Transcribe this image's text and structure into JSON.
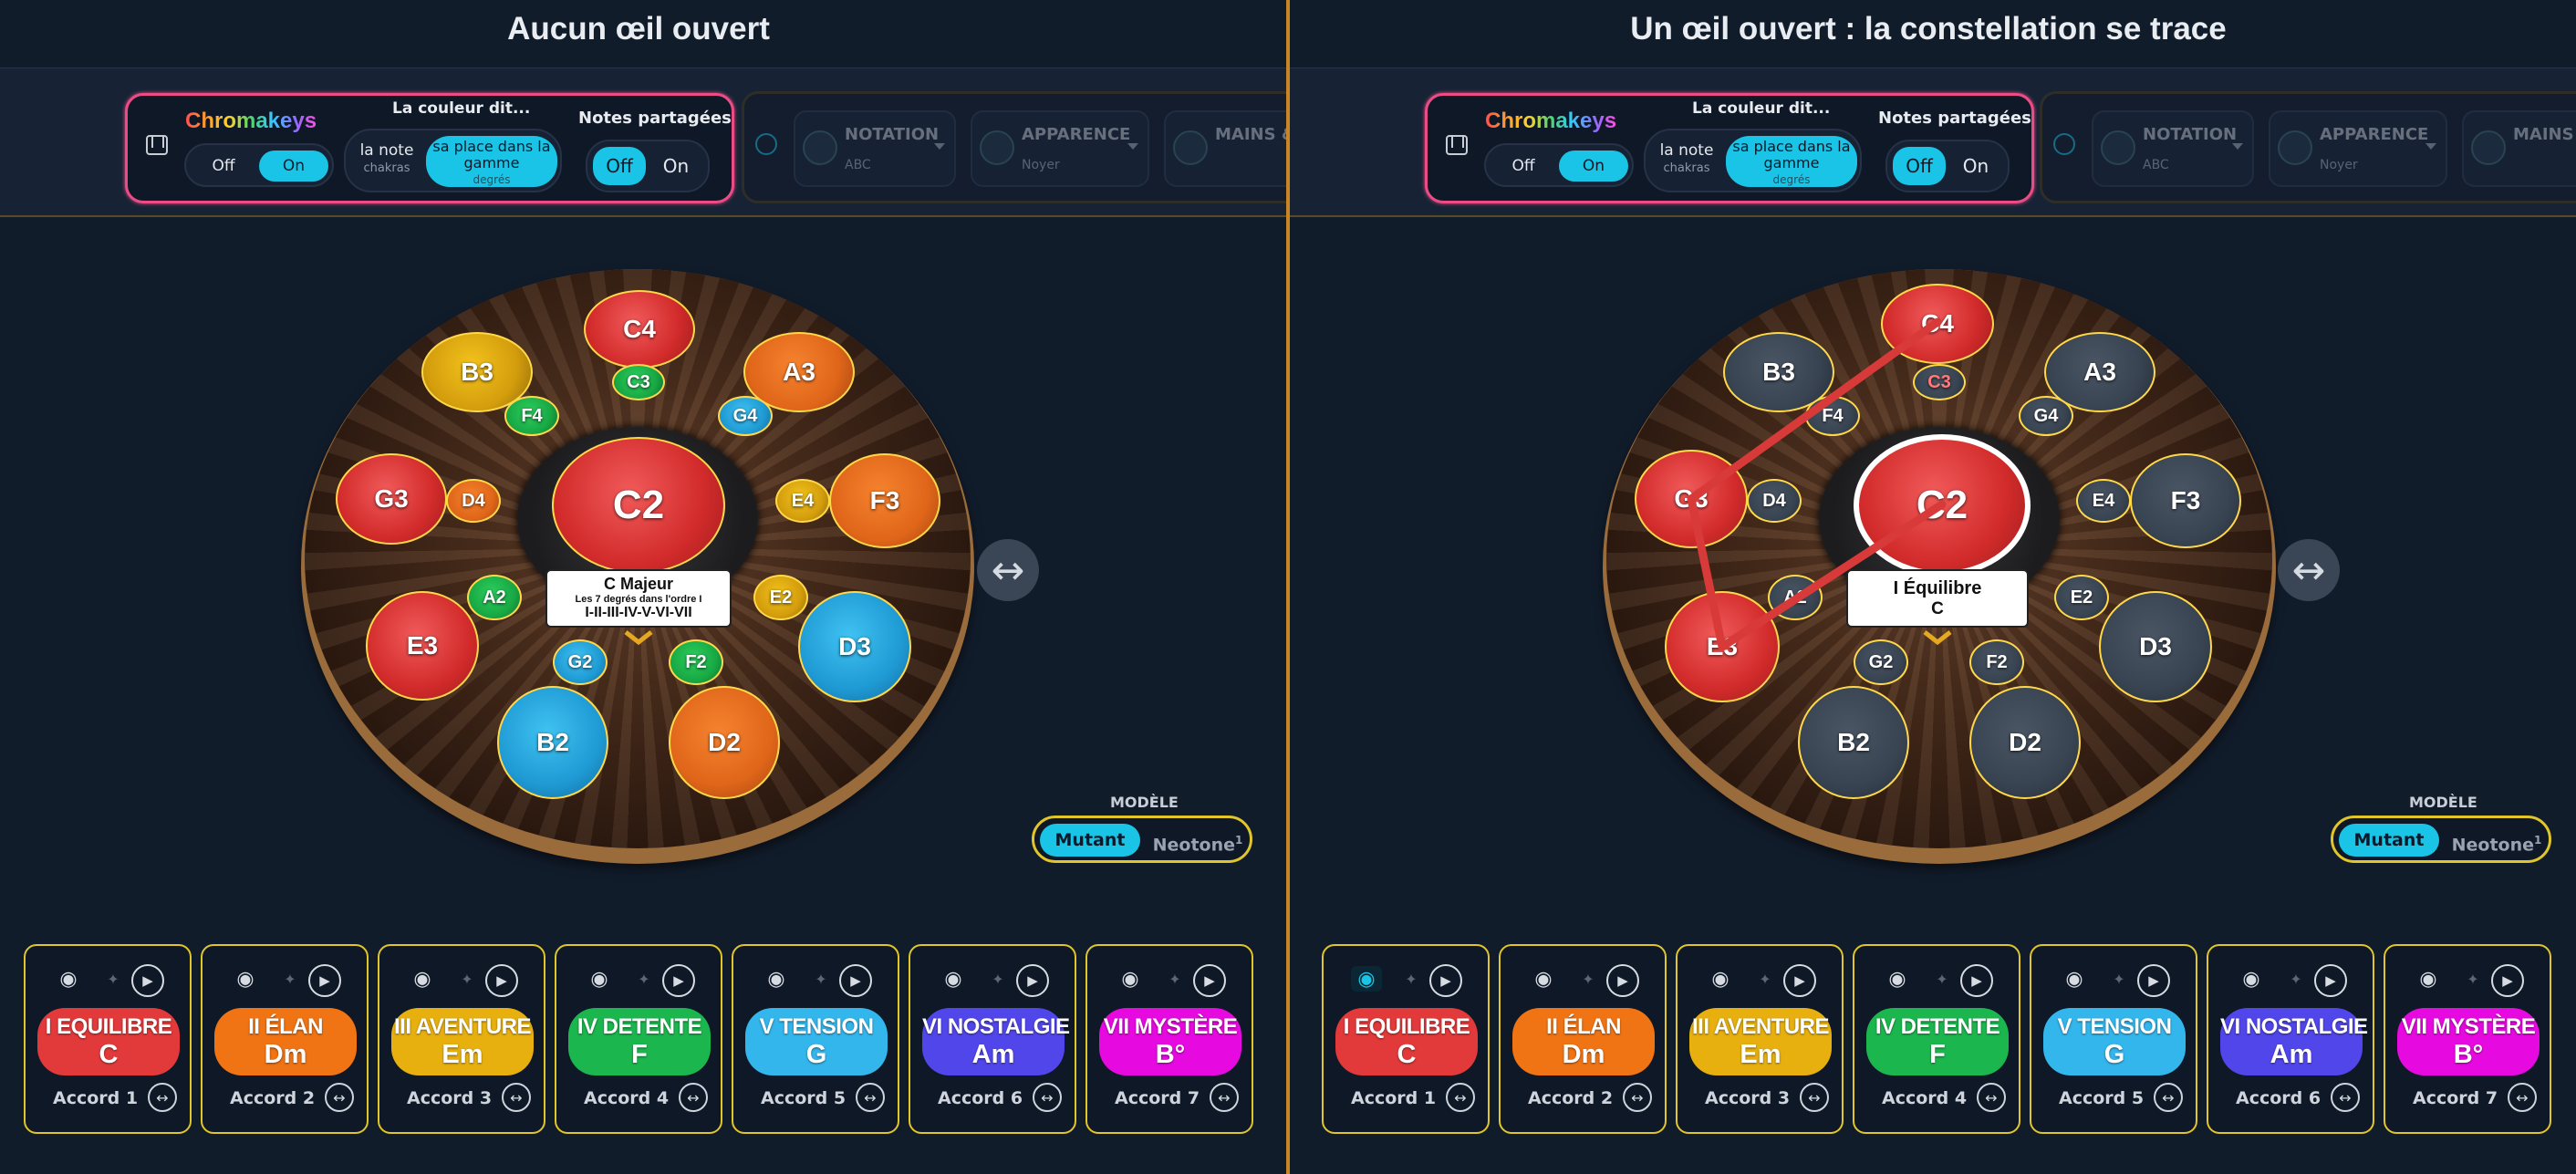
{
  "titles": {
    "left": "Aucun œil ouvert",
    "right": "Un œil ouvert : la constellation se trace"
  },
  "toolbar": {
    "brand": "Chromakeys",
    "off": "Off",
    "on": "On",
    "couleur_title": "La couleur dit...",
    "note_main": "la note",
    "note_sub": "chakras",
    "place_main": "sa place dans la gamme",
    "place_sub": "degrés",
    "notes_title": "Notes partagées",
    "notation_label": "NOTATION",
    "notation_value": "ABC",
    "apparence_label": "APPARENCE",
    "apparence_value": "Noyer",
    "mains_label": "MAINS & DOIGTÉ"
  },
  "center_label": {
    "left_title": "C Majeur",
    "left_sub": "Les 7 degrés dans l'ordre I",
    "left_roman": "I-II-III-IV-V-VI-VII",
    "right_title": "I Équilibre",
    "right_sub": "C"
  },
  "notes": {
    "C2": "C2",
    "C3": "C3",
    "C4": "C4",
    "D2": "D2",
    "D3": "D3",
    "D4": "D4",
    "E2": "E2",
    "E3": "E3",
    "E4": "E4",
    "F2": "F2",
    "F3": "F3",
    "F4": "F4",
    "G2": "G2",
    "G3": "G3",
    "G4": "G4",
    "A2": "A2",
    "A3": "A3",
    "B2": "B2",
    "B3": "B3"
  },
  "modele": {
    "title": "MODÈLE",
    "mutant": "Mutant",
    "neotone": "Neotone",
    "neotone_sup": "1"
  },
  "chords": [
    {
      "title": "I EQUILIBRE",
      "chord": "C",
      "label": "Accord 1",
      "color": "#e23a3a"
    },
    {
      "title": "II ÉLAN",
      "chord": "Dm",
      "label": "Accord 2",
      "color": "#f07414"
    },
    {
      "title": "III AVENTURE",
      "chord": "Em",
      "label": "Accord 3",
      "color": "#e7b00f"
    },
    {
      "title": "IV DETENTE",
      "chord": "F",
      "label": "Accord 4",
      "color": "#1cb64f"
    },
    {
      "title": "V TENSION",
      "chord": "G",
      "label": "Accord 5",
      "color": "#33b6ec"
    },
    {
      "title": "VI NOSTALGIE",
      "chord": "Am",
      "label": "Accord 6",
      "color": "#5146ea"
    },
    {
      "title": "VII MYSTÈRE",
      "chord": "B°",
      "label": "Accord 7",
      "color": "#e60ae0"
    }
  ],
  "icons": {
    "arrow": "↔",
    "play": "▶",
    "eye": "◉",
    "sparkle": "✦",
    "keyboard": "piano-icon"
  }
}
